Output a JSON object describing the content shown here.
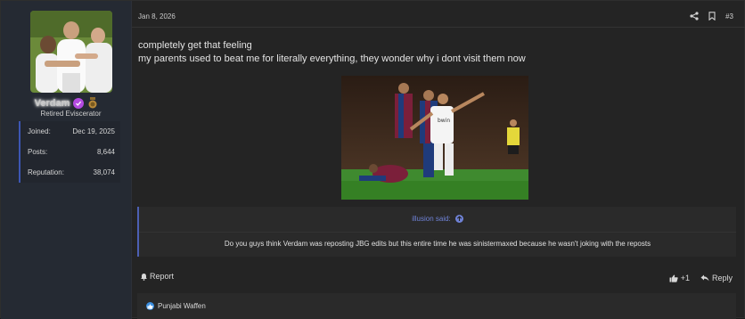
{
  "user": {
    "name": "Verdam",
    "title": "Retired Eviscerator",
    "stats": [
      {
        "label": "Joined:",
        "value": "Dec 19, 2025"
      },
      {
        "label": "Posts:",
        "value": "8,644"
      },
      {
        "label": "Reputation:",
        "value": "38,074"
      }
    ]
  },
  "post": {
    "date": "Jan 8, 2026",
    "number": "#3",
    "lines": [
      "completely get that feeling",
      "my parents used to beat me for literally everything, they wonder why i dont visit them now"
    ],
    "image_icon": "football-photo"
  },
  "quote": {
    "author": "illusion said:",
    "text": "Do you guys think Verdam was reposting JBG edits but this entire time he was sinistermaxed because he wasn't joking with the reposts"
  },
  "actions": {
    "report": "Report",
    "like_count": "+1",
    "reply": "Reply"
  },
  "reactions": {
    "users": "Punjabi Waffen"
  },
  "colors": {
    "accent": "#4c5fb3",
    "quote_author": "#6f82d6",
    "verified": "#b44be1",
    "like": "#3b8fe0"
  }
}
